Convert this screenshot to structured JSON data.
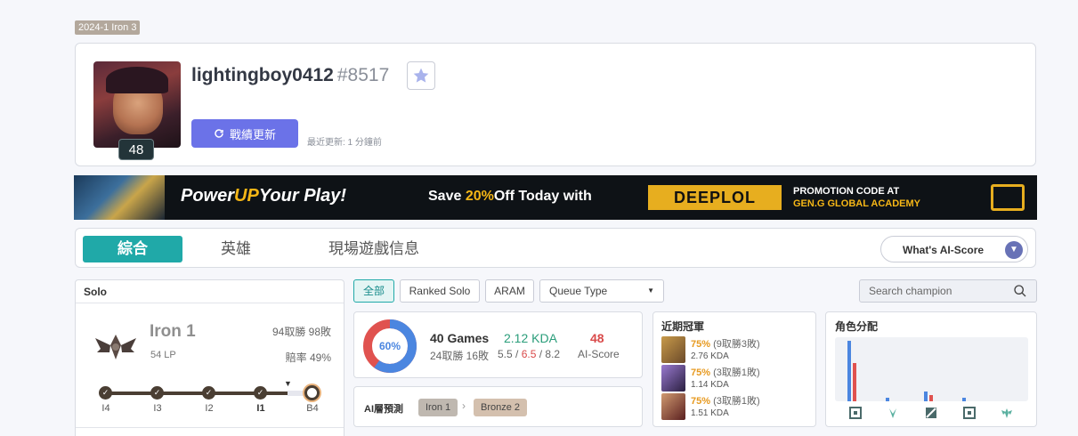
{
  "season_badge": "2024-1  Iron 3",
  "profile": {
    "name": "lightingboy0412",
    "tag": "#8517",
    "level": "48",
    "refresh_label": "戰績更新",
    "last_update": "最近更新: 1 分鐘前"
  },
  "banner": {
    "headline_a": "Power",
    "headline_b": "UP",
    "headline_c": "Your Play!",
    "save_a": "Save ",
    "save_b": "20%",
    "save_c": "Off Today with",
    "brand": "DEEPLOL",
    "promo_line1": "PROMOTION CODE AT",
    "promo_line2": "GEN.G GLOBAL ACADEMY"
  },
  "tabs": [
    {
      "label": "綜合"
    },
    {
      "label": "英雄"
    },
    {
      "label": "現場遊戲信息"
    }
  ],
  "ai_score_button": "What's AI-Score",
  "solo": {
    "header": "Solo",
    "tier": "Iron 1",
    "lp": "54 LP",
    "wl": "94取勝 98敗",
    "winrate": "賠率 49%",
    "ladder": [
      "I4",
      "I3",
      "I2",
      "I1",
      "B4"
    ]
  },
  "filters": {
    "all": "全部",
    "ranked_solo": "Ranked Solo",
    "aram": "ARAM",
    "queue_type": "Queue Type",
    "search_placeholder": "Search champion"
  },
  "summary": {
    "winrate_pct": 60,
    "winrate_label": "60%",
    "games": "40 Games",
    "games_wl": "24取勝 16敗",
    "kda": "2.12 KDA",
    "kills": "5.5",
    "deaths": "6.5",
    "assists": "8.2",
    "ai_score": "48",
    "ai_score_label": "AI-Score"
  },
  "ai_tier": {
    "title": "AI層預測",
    "current": "Iron 1",
    "predicted": "Bronze 2"
  },
  "recent_champions": {
    "title": "近期冠軍",
    "items": [
      {
        "pct": "75%",
        "record": " (9取勝3敗)",
        "kda": "2.76 KDA",
        "color": "#6b4a2a"
      },
      {
        "pct": "75%",
        "record": " (3取勝1敗)",
        "kda": "1.14 KDA",
        "color": "#4a3a6a"
      },
      {
        "pct": "75%",
        "record": " (3取勝1敗)",
        "kda": "1.51 KDA",
        "color": "#6a2a2a"
      }
    ]
  },
  "roles": {
    "title": "角色分配",
    "bars": [
      {
        "role": "top",
        "blue": 0.95,
        "red": 0.6
      },
      {
        "role": "jungle",
        "blue": 0.06,
        "red": 0.0
      },
      {
        "role": "mid",
        "blue": 0.15,
        "red": 0.1
      },
      {
        "role": "bot",
        "blue": 0.06,
        "red": 0.0
      },
      {
        "role": "support",
        "blue": 0.0,
        "red": 0.0
      }
    ],
    "colors": {
      "blue": "#4b86e0",
      "red": "#e0524f"
    }
  }
}
